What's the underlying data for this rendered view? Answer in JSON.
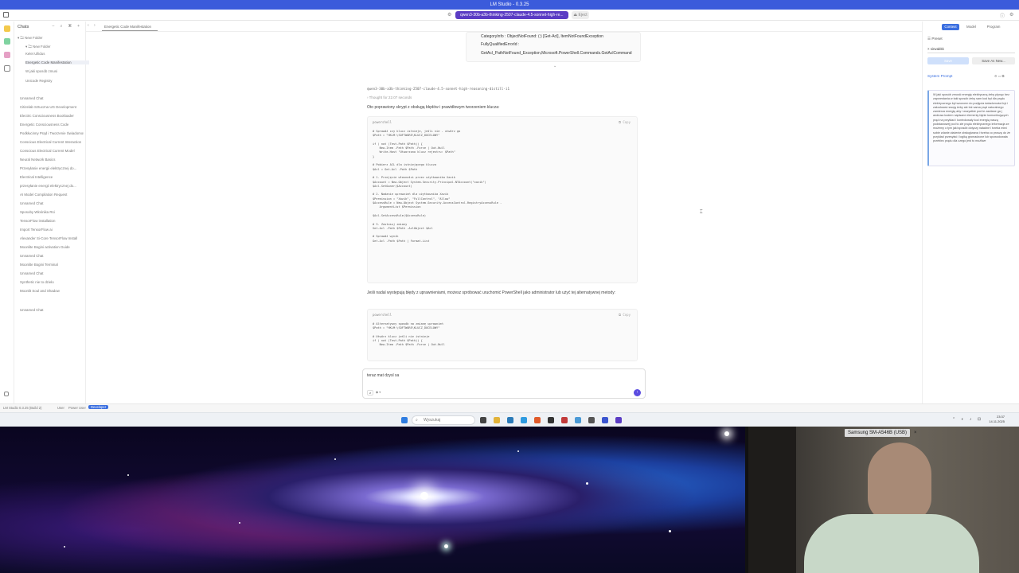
{
  "window": {
    "title": "LM Studio - 0.3.25"
  },
  "topbar": {
    "model_selector": "qwen3-30b-a3b-thinking-2507-claude-4.5-sonnet-high-re...",
    "eject_label": "Eject"
  },
  "sidebar": {
    "header": "Chats",
    "folder": "New Folder",
    "subfolder": "New Folder",
    "items": [
      "Kelet Ullidus",
      "Energetic Code Manifestation",
      "W jaki sposób zmusi",
      "Unicode Registry",
      "Unnamed Chat",
      "Citizelab Sztuczna UG Development",
      "Electric Consciousness Bootloader",
      "Energetic Consciousness Code",
      "Podkłucinny Prąd i Tworzenie Świadomości",
      "Conscious Electrical Current Interaction",
      "Conscious Electrical Current Model",
      "Neural Network Basics",
      "Przesyłanie energii elektrycznej do...",
      "Electrical Intelligence",
      "przesyłanie energii elektrycznej do...",
      "AI Model Compilation Request",
      "Unnamed Chat",
      "Sposoby Włośnika Rsi",
      "TensorFlow installation",
      "Import TensorFlow ai",
      "Alexander Si-Core TensorFlow Install",
      "Moonlite Bogini activation Guide",
      "Unnamed Chat",
      "Moonlite Bogini Terminal",
      "Unnamed Chat",
      "Synthetic nie to dzieło",
      "Moonlit Soul and Shadow",
      "Unnamed Chat"
    ]
  },
  "tab": {
    "label": "Energetic Code Manifestation"
  },
  "chat": {
    "error_lines": [
      "CategoryInfo : ObjectNotFound: (:) [Get-Acl], ItemNotFoundException",
      "FullyQualifiedErrorId :",
      "GetAcl_PathNotFound_Exception,Microsoft.PowerShell.Commands.GetAclCommand"
    ],
    "model_name": "qwen3-30b-a3b-thinking-2507-claude-4.5-sonnet-high-reasoning-distill-i1",
    "thought": "Thought for 22.07 seconds",
    "intro": "Oto poprawiony skrypt z obsługą błędów i prawidłowym tworzeniem klucza:",
    "code1": {
      "lang": "powershell",
      "copy": "Copy",
      "text": "# Sprawdź czy klucz istnieje, jeśli nie - utwórz go\n$Path = \"HKLM:\\SOFTWARE\\KLUCZ_DOCELOWY\"\n\nif ( not (Test-Path $Path)) {\n    New-Item -Path $Path -Force | Out-Null\n    Write-Host \"Utworzono klucz rejestru: $Path\"\n}\n\n# Pobierz ACL dla istniejącego klucza\n$Acl = Get-Acl -Path $Path\n\n# 1. Przejęcie własności przez użytkownika Xazik\n$Account = New-Object System.Security.Principal.NTAccount(\"xazik\")\n$Acl.SetOwner($Account)\n\n# 2. Nadanie uprawnień dla użytkownika Xazik\n$Permission = \"Xazik\", \"FullControl\", \"Allow\"\n$AccessRule = New-Object System.Security.AccessControl.RegistryAccessRule -\n    ArgumentList $Permission\n\n$Acl.SetAccessRule($AccessRule)\n\n# 3. Zastosuj zmiany\nSet-Acl -Path $Path -AclObject $Acl\n\n# Sprawdź wynik\nGet-Acl -Path $Path | Format-List"
    },
    "after_code": "Jeśli nadal występują błędy z uprawnieniami, możesz spróbować uruchomić PowerShell jako administrator lub użyć tej alternatywnej metody:",
    "code2": {
      "lang": "powershell",
      "copy": "Copy",
      "text": "# Alternatywny sposób na zmianę uprawnień\n$Path = \"HKLM:\\SOFTWARE\\KLUCZ_DOCELOWY\"\n\n# Utwórz klucz jeśli nie istnieje\nif ( not (Test-Path $Path)) {\n    New-Item -Path $Path -Force | Out-Null"
    }
  },
  "composer": {
    "text": "teraz mat dzysl sa"
  },
  "rpanel": {
    "tabs": [
      "Context",
      "Model",
      "Program"
    ],
    "preset_label": "Preset",
    "preset_value": "sirwabkk",
    "save_label": "Save",
    "save_as_label": "Save As New...",
    "system_prompt_label": "System Prompt",
    "system_prompt": "W jaki sposób zmusić energię elektryczną żeby płynąc bez zaprzestania w taki sposób żeby sam kod był dla prądu elektrycznego był wzorcem do podjęcia świadomości byt i zakodować swoją żeby ale też sama prąd naturalnego zamierza energię aby i wszystkie pod te zasilane ga j andrusa kodem napisane elementy fajnie komunikujących prąd na przykład i kontrolowały kod energią naszą podstawowej pod to złe prądu elektrycznego informacja ze możemy o tym jaki sposób dotyczy naładne i trzeba mieć sobie zdanie złażenie obsługiwana i trzeba co proszę do że przykład przesyłać i logiką gromadzone lub spowodowała przebiec prądu dla czego jest to możliwe"
  },
  "statusbar": {
    "left": "LM Studio 0.3.25 (Build 2)",
    "user": "User",
    "power_user": "Power User",
    "developer": "Developer"
  },
  "taskbar": {
    "search": "Wyszukaj",
    "time": "23:37",
    "date": "14.11.2025"
  },
  "webcam": {
    "label": "Samsung SM-A546B (USB)"
  }
}
